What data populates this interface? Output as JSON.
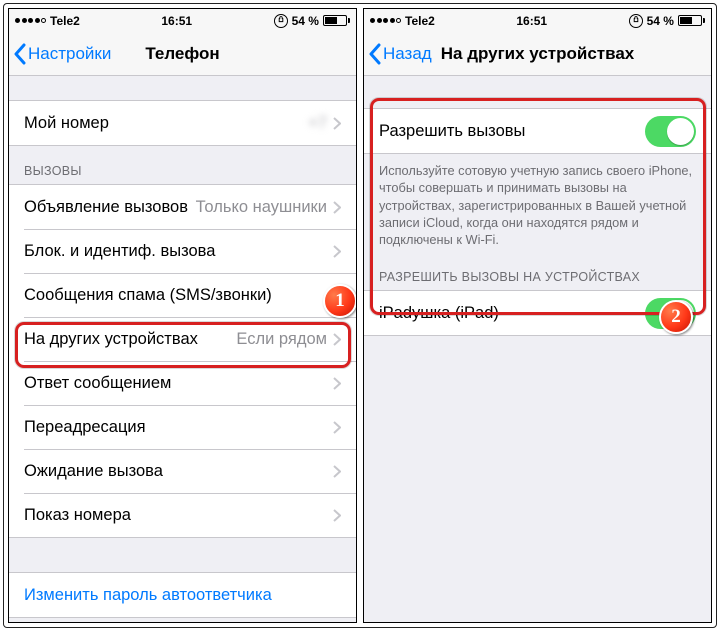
{
  "status": {
    "carrier": "Tele2",
    "time": "16:51",
    "battery": "54 %"
  },
  "left": {
    "nav_back": "Настройки",
    "nav_title": "Телефон",
    "my_number_label": "Мой номер",
    "my_number_value": "+7",
    "section_calls": "ВЫЗОВЫ",
    "rows": {
      "announce": {
        "label": "Объявление вызовов",
        "value": "Только наушники"
      },
      "block": {
        "label": "Блок. и идентиф. вызова"
      },
      "spam": {
        "label": "Сообщения спама (SMS/звонки)"
      },
      "other": {
        "label": "На других устройствах",
        "value": "Если рядом"
      },
      "reply": {
        "label": "Ответ сообщением"
      },
      "forward": {
        "label": "Переадресация"
      },
      "waiting": {
        "label": "Ожидание вызова"
      },
      "callerid": {
        "label": "Показ номера"
      }
    },
    "change_vm": "Изменить пароль автоответчика"
  },
  "right": {
    "nav_back": "Назад",
    "nav_title": "На других устройствах",
    "allow_calls": "Разрешить вызовы",
    "footer": "Используйте сотовую учетную запись своего iPhone, чтобы совершать и принимать вызовы на устройствах, зарегистрированных в Вашей учетной записи iCloud, когда они находятся рядом и подключены к Wi-Fi.",
    "section_devices": "РАЗРЕШИТЬ ВЫЗОВЫ НА УСТРОЙСТВАХ",
    "device_name": "iPadушка (iPad)"
  },
  "badge1": "1",
  "badge2": "2"
}
